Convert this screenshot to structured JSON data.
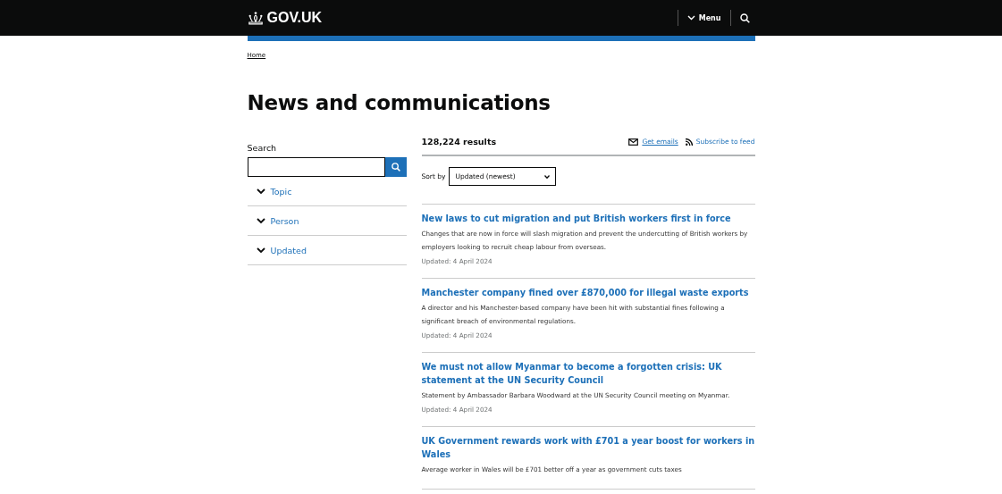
{
  "header": {
    "logo": "GOV.UK",
    "menu": "Menu"
  },
  "breadcrumb": "Home",
  "title": "News and communications",
  "search": {
    "label": "Search"
  },
  "filters": [
    {
      "label": "Topic",
      "expanded": false
    },
    {
      "label": "Person",
      "expanded": false
    },
    {
      "label": "Updated",
      "expanded": false
    }
  ],
  "results": {
    "count": "128,224 results",
    "get_emails": "Get emails",
    "subscribe": "Subscribe to feed",
    "sort_label": "Sort by",
    "sort_value": "Updated (newest)"
  },
  "items": [
    {
      "title": "New laws to cut migration and put British workers first in force",
      "description": "Changes that are now in force will slash migration and prevent the undercutting of British workers by employers looking to recruit cheap labour from overseas.",
      "updated": "Updated: 4 April 2024"
    },
    {
      "title": "Manchester company fined over £870,000 for illegal waste exports",
      "description": "A director and his Manchester-based company have been hit with substantial fines following a significant breach of environmental regulations.",
      "updated": "Updated: 4 April 2024"
    },
    {
      "title": "We must not allow Myanmar to become a forgotten crisis: UK statement at the UN Security Council",
      "description": "Statement by Ambassador Barbara Woodward at the UN Security Council meeting on Myanmar.",
      "updated": "Updated: 4 April 2024"
    },
    {
      "title": "UK Government rewards work with £701 a year boost for workers in Wales",
      "description": "Average worker in Wales will be £701 better off a year as government cuts taxes"
    }
  ]
}
